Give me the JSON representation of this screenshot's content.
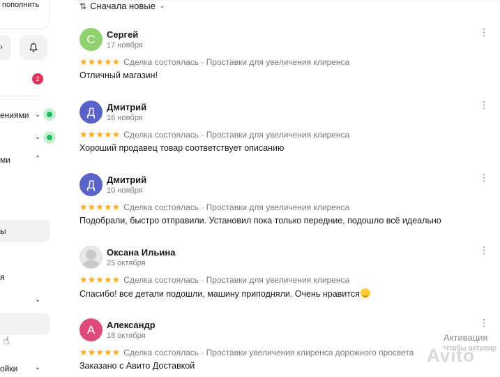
{
  "sidebar": {
    "topup_label": "пополнить",
    "badge_count": "2",
    "items": [
      {
        "label": "ениями"
      },
      {
        "label": "ми"
      },
      {
        "label": "ы"
      },
      {
        "label": "я"
      },
      {
        "label": "ойки"
      }
    ]
  },
  "sort": {
    "label": "Сначала новые"
  },
  "reviews": [
    {
      "initial": "С",
      "name": "Сергей",
      "date": "17 ноября",
      "stars": "★★★★★",
      "meta": "Сделка состоялась · Проставки для увеличения клиренса",
      "text": "Отличный магазин!"
    },
    {
      "initial": "Д",
      "name": "Дмитрий",
      "date": "16 ноября",
      "stars": "★★★★★",
      "meta": "Сделка состоялась · Проставки для увеличения клиренса",
      "text": "Хороший продавец товар соответствует описанию"
    },
    {
      "initial": "Д",
      "name": "Дмитрий",
      "date": "10 ноября",
      "stars": "★★★★★",
      "meta": "Сделка состоялась · Проставки для увеличения клиренса",
      "text": "Подобрали, быстро отправили. Установил пока только передние, подошло всё идеально"
    },
    {
      "initial": "",
      "name": "Оксана Ильина",
      "date": "25 октября",
      "stars": "★★★★★",
      "meta": "Сделка состоялась · Проставки для увеличения клиренса",
      "text": "Спасибо! все детали подошли, машину приподняли. Очень нравится"
    },
    {
      "initial": "А",
      "name": "Александр",
      "date": "18 октября",
      "stars": "★★★★★",
      "meta": "Сделка состоялась · Проставки увеличения клиренса дорожного просвета",
      "text": "Заказано с Авито Доставкой"
    }
  ],
  "watermark": {
    "title": "Активация",
    "subtitle": "Чтобы активир",
    "logo": "Avito"
  },
  "colors": {
    "star": "#ffab1a",
    "badge": "#e0355a",
    "online_dot": "#1dbf62",
    "avatar_green": "#8fd16e",
    "avatar_blue": "#5a63c7",
    "avatar_pink": "#e04a7a"
  }
}
